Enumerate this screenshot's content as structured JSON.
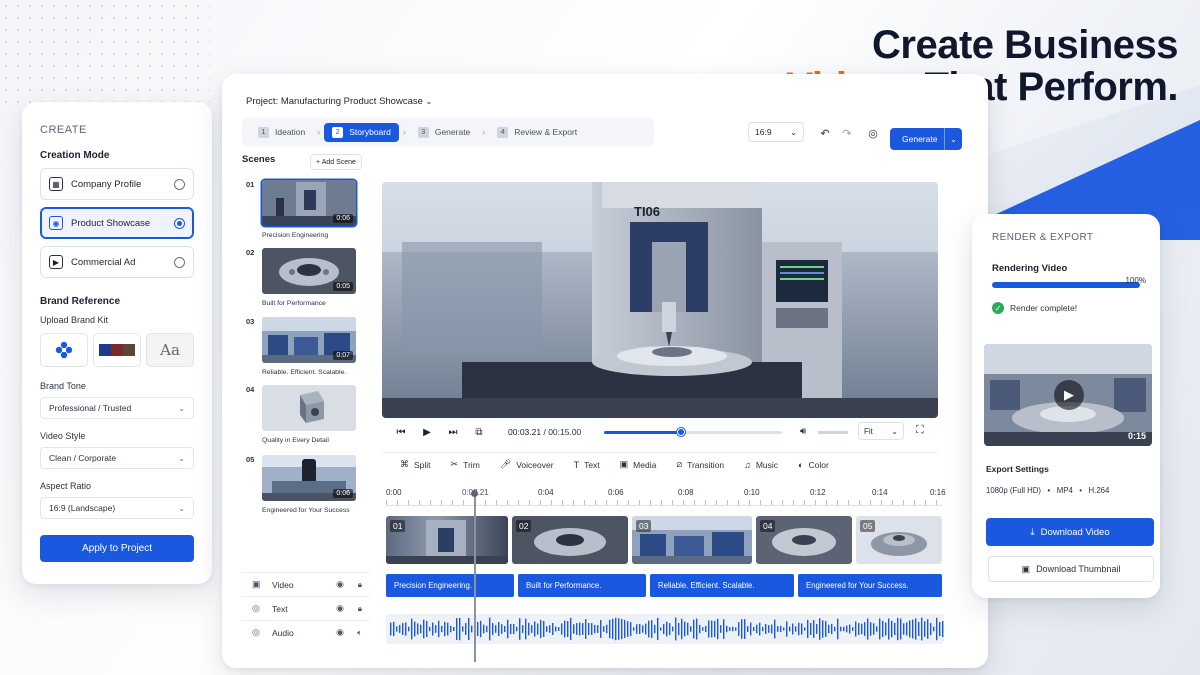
{
  "headline": {
    "line1": "Create Business",
    "accent": "Videos",
    "line2_rest": " That Perform."
  },
  "colors": {
    "accent_blue": "#1a58e0",
    "accent_orange": "#f26a1b",
    "success": "#2fa85c"
  },
  "left_panel": {
    "caption": "CREATE",
    "creation_mode_title": "Creation Mode",
    "modes": [
      {
        "label": "Company Profile",
        "icon": "building-icon",
        "selected": false
      },
      {
        "label": "Product Showcase",
        "icon": "product-icon",
        "selected": true
      },
      {
        "label": "Commercial Ad",
        "icon": "ad-icon",
        "selected": false
      }
    ],
    "brand_reference_title": "Brand Reference",
    "upload_label": "Upload Brand Kit",
    "brand_swatches": [
      "#1f3a8a",
      "#7b2a2a",
      "#5b4636"
    ],
    "font_sample": "Aa",
    "brand_tone_label": "Brand Tone",
    "brand_tone_value": "Professional / Trusted",
    "video_style_label": "Video Style",
    "video_style_value": "Clean / Corporate",
    "aspect_ratio_label": "Aspect Ratio",
    "aspect_ratio_value": "16:9 (Landscape)",
    "apply_label": "Apply to Project"
  },
  "editor": {
    "project_title": "Project: Manufacturing Product Showcase",
    "steps": [
      {
        "num": "1",
        "label": "Ideation",
        "active": false
      },
      {
        "num": "2",
        "label": "Storyboard",
        "active": true
      },
      {
        "num": "3",
        "label": "Generate",
        "active": false
      },
      {
        "num": "4",
        "label": "Review & Export",
        "active": false
      }
    ],
    "ratio": "16:9",
    "generate_label": "Generate",
    "scenes_title": "Scenes",
    "add_scene_label": "+ Add Scene",
    "scenes": [
      {
        "num": "01",
        "duration": "0:06",
        "caption": "Precision Engineering"
      },
      {
        "num": "02",
        "duration": "0:05",
        "caption": "Built for Performance"
      },
      {
        "num": "03",
        "duration": "0:07",
        "caption": "Reliable. Efficient. Scalable."
      },
      {
        "num": "04",
        "duration": "",
        "caption": "Quality in Every Detail"
      },
      {
        "num": "05",
        "duration": "0:06",
        "caption": "Engineered for Your Success"
      }
    ],
    "tracks": [
      {
        "label": "Video",
        "icon": "image-icon"
      },
      {
        "label": "Text",
        "icon": "text-track-icon"
      },
      {
        "label": "Audio",
        "icon": "audio-track-icon"
      }
    ],
    "player": {
      "current": "00:03.21",
      "total": "00:15.00",
      "progress": 0.43,
      "fit": "Fit"
    },
    "edit_tools": [
      "Split",
      "Trim",
      "Voiceover",
      "Text",
      "Media",
      "Transition",
      "Music",
      "Color"
    ],
    "ruler": [
      "0:00",
      "0:03.21",
      "0:04",
      "0:06",
      "0:08",
      "0:10",
      "0:12",
      "0:14",
      "0:16"
    ],
    "clips": [
      "01",
      "02",
      "03",
      "04",
      "05"
    ],
    "captions": [
      "Precision Engineering.",
      "Built for Performance.",
      "Reliable. Efficient. Scalable.",
      "Engineered for Your Success."
    ],
    "machine_label": "TI06"
  },
  "right_panel": {
    "caption": "RENDER & EXPORT",
    "rendering_label": "Rendering Video",
    "percent_label": "100%",
    "progress": 1.0,
    "status": "Render complete!",
    "thumb_duration": "0:15",
    "export_settings_label": "Export Settings",
    "export_values": "1080p (Full HD)   •   MP4   •   H.264",
    "download_video_label": "Download Video",
    "download_thumb_label": "Download Thumbnail"
  }
}
